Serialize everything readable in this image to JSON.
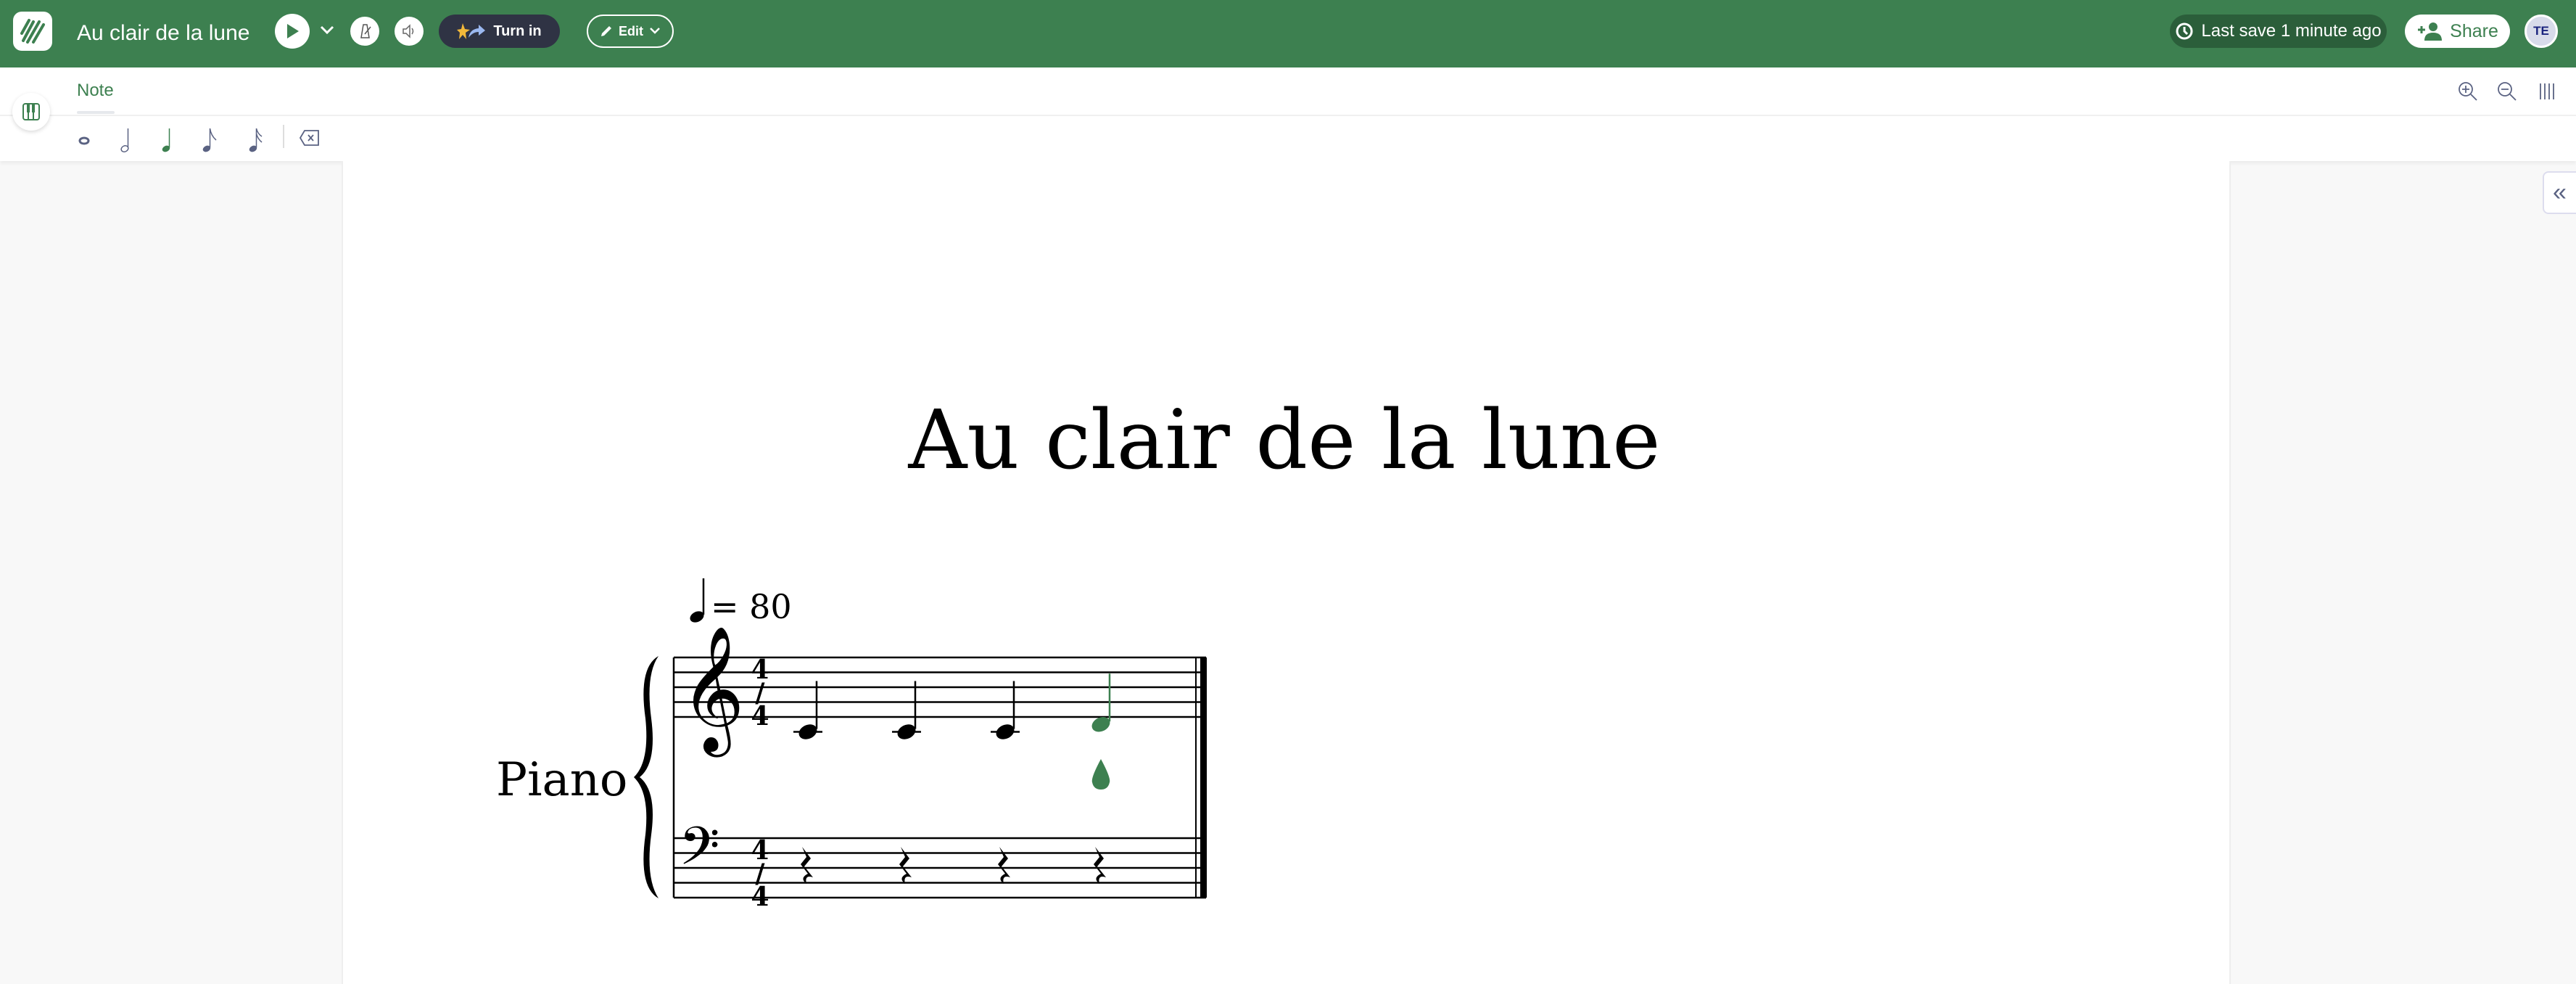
{
  "header": {
    "title": "Au clair de la lune",
    "turn_in_label": "Turn in",
    "edit_label": "Edit",
    "last_save": "Last save 1 minute ago",
    "share_label": "Share",
    "avatar_initials": "TE",
    "color": "#3d8050"
  },
  "toolbar": {
    "tabs": [
      {
        "label": "Note",
        "active": true
      }
    ],
    "durations": [
      "whole-note-icon",
      "half-note-icon",
      "quarter-note-icon",
      "eighth-note-icon",
      "sixteenth-note-icon"
    ],
    "selected_duration": "quarter"
  },
  "score": {
    "title": "Au clair de la lune",
    "tempo": "= 80",
    "instrument": "Piano",
    "time_signature": "4/4",
    "treble_notes": [
      "C4",
      "C4",
      "C4",
      "D4"
    ],
    "bass": [
      "rest",
      "rest",
      "rest",
      "rest"
    ],
    "accent": "#3d8050"
  }
}
